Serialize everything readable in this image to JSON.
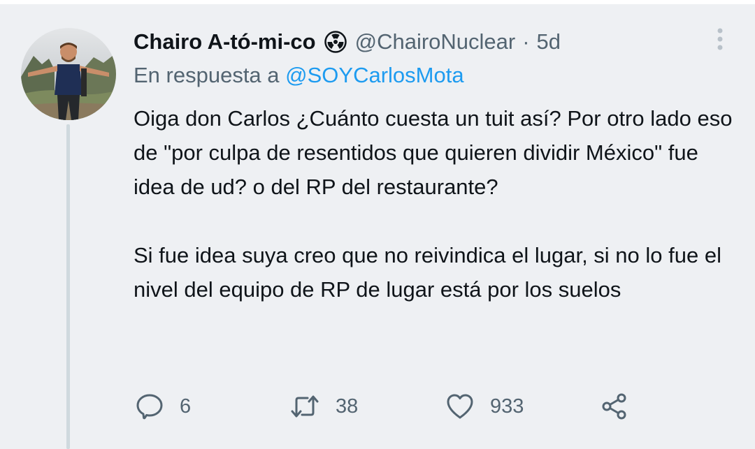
{
  "tweet": {
    "display_name": "Chairo A-tó-mi-co",
    "badge_icon": "radioactive-icon",
    "handle": "@ChairoNuclear",
    "separator": "·",
    "time": "5d",
    "reply_prefix": "En respuesta a",
    "reply_handle": "@SOYCarlosMota",
    "paragraphs": [
      "Oiga don Carlos ¿Cuánto cuesta un tuit así? Por otro lado eso de \"por culpa de resentidos que quieren dividir México\" fue idea de ud? o del RP del restaurante?",
      "Si fue idea suya creo que no reivindica el lugar, si no lo fue el nivel del equipo de RP de lugar está por los suelos"
    ]
  },
  "actions": {
    "replies": "6",
    "retweets": "38",
    "likes": "933",
    "reply_icon": "reply-icon",
    "retweet_icon": "retweet-icon",
    "like_icon": "heart-icon",
    "share_icon": "share-icon"
  },
  "colors": {
    "background": "#eef0f3",
    "text": "#0f1419",
    "secondary": "#536471",
    "link": "#1d9bf0",
    "thread_line": "#cfd9de"
  }
}
